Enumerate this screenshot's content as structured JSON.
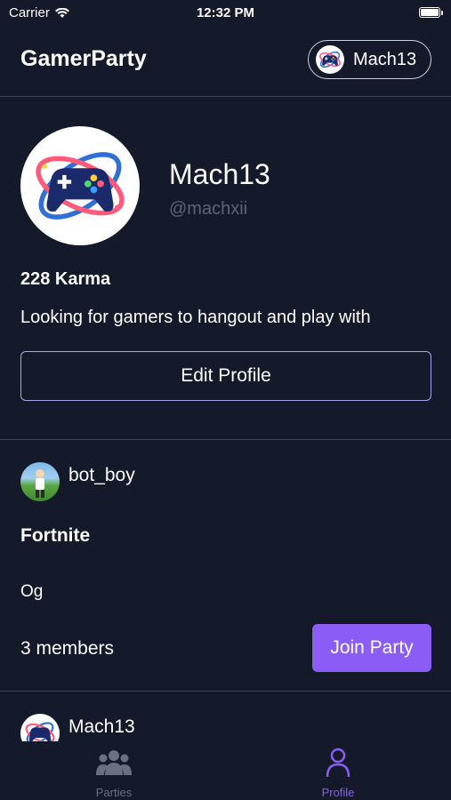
{
  "status_bar": {
    "carrier": "Carrier",
    "time": "12:32 PM",
    "battery_level": 1.0
  },
  "header": {
    "title": "GamerParty",
    "user_pill_name": "Mach13"
  },
  "profile": {
    "name": "Mach13",
    "handle": "@machxii",
    "karma": "228 Karma",
    "bio": "Looking for gamers to hangout and play with",
    "edit_button": "Edit Profile"
  },
  "parties": [
    {
      "host": "bot_boy",
      "game": "Fortnite",
      "description": "Og",
      "members": "3 members",
      "join_button": "Join Party"
    },
    {
      "host": "Mach13"
    }
  ],
  "tabs": [
    {
      "label": "Parties",
      "icon": "people-icon",
      "active": false
    },
    {
      "label": "Profile",
      "icon": "person-icon",
      "active": true
    }
  ],
  "colors": {
    "background": "#141a2a",
    "accent": "#8b5cf6",
    "divider": "#3b4152",
    "muted": "#5f6473"
  }
}
